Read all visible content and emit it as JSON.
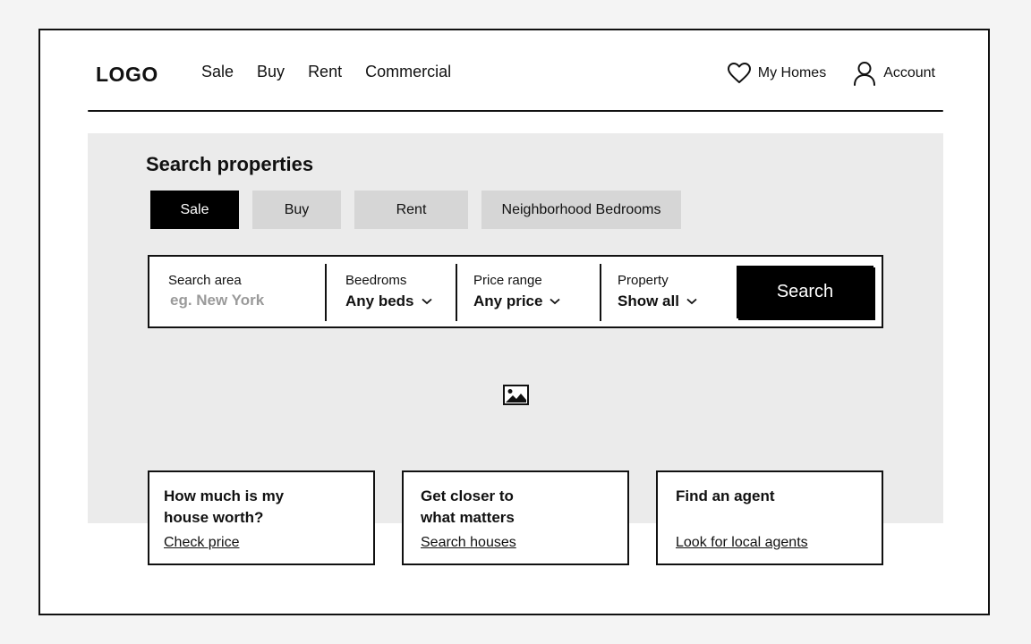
{
  "header": {
    "logo": "LOGO",
    "nav": [
      "Sale",
      "Buy",
      "Rent",
      "Commercial"
    ],
    "my_homes": "My Homes",
    "account": "Account"
  },
  "hero": {
    "title": "Search properties",
    "tabs": [
      {
        "label": "Sale",
        "active": true
      },
      {
        "label": "Buy",
        "active": false
      },
      {
        "label": "Rent",
        "active": false
      },
      {
        "label": "Neighborhood Bedrooms",
        "active": false
      }
    ]
  },
  "search": {
    "area_label": "Search area",
    "area_placeholder": "eg. New York",
    "beds_label": "Beedroms",
    "beds_value": "Any beds",
    "price_label": "Price range",
    "price_value": "Any price",
    "property_label": "Property",
    "property_value": "Show all",
    "button": "Search"
  },
  "cards": [
    {
      "title": "How much is my house worth?",
      "link": "Check price"
    },
    {
      "title": "Get closer to what matters",
      "link": "Search houses"
    },
    {
      "title": "Find an agent",
      "link": "Look for local agents"
    }
  ],
  "icons": {
    "favorites": "heart-icon",
    "account": "user-icon",
    "dropdown": "chevron-down-icon",
    "placeholder": "image-icon"
  }
}
